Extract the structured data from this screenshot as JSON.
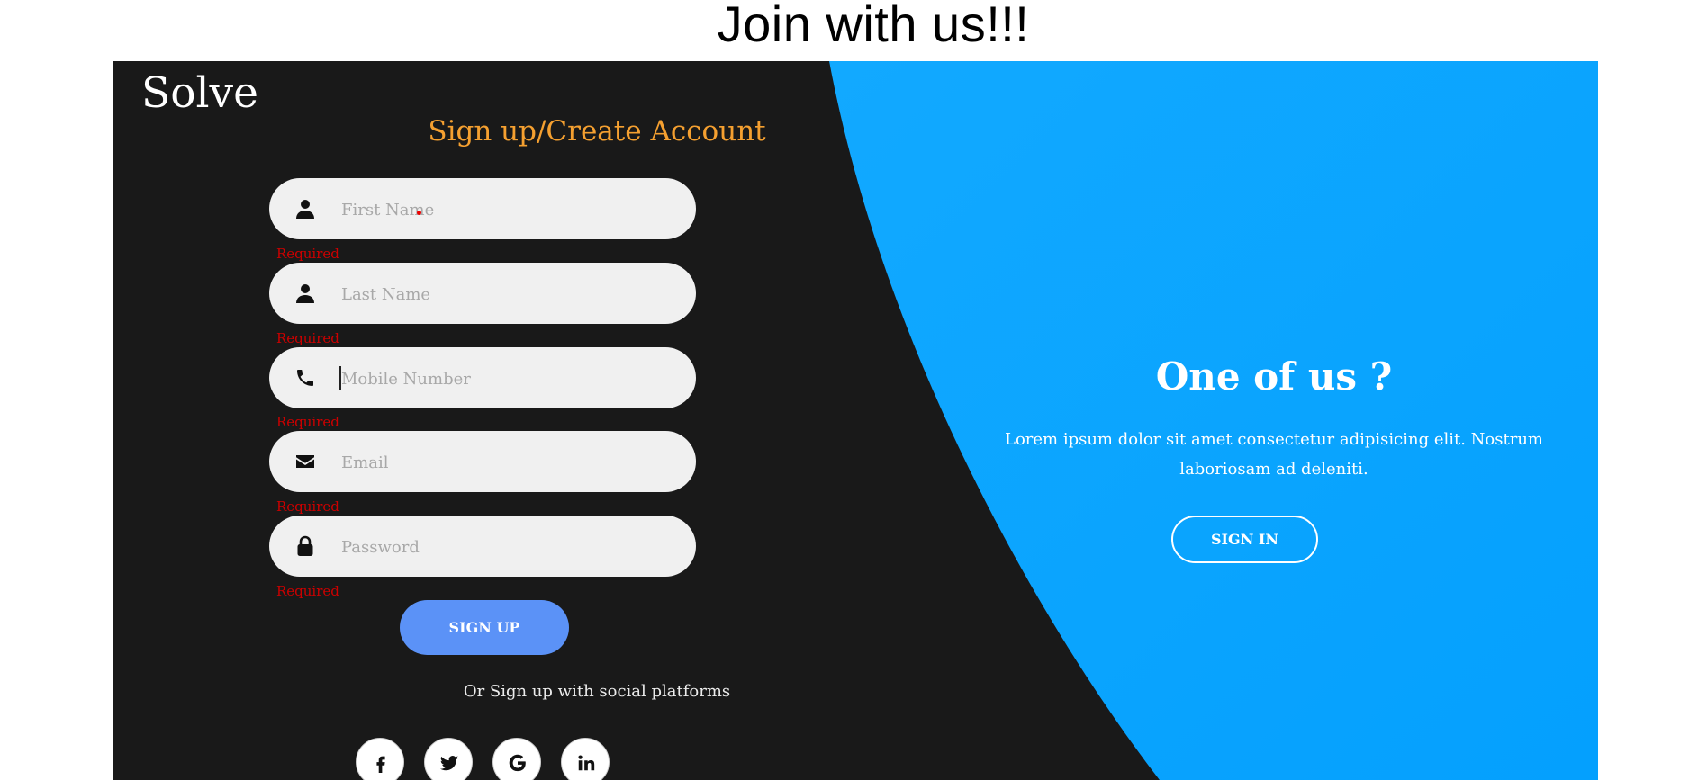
{
  "page_title": "Join with us!!!",
  "brand": "Solve",
  "signup": {
    "title": "Sign up/Create Account",
    "fields": [
      {
        "placeholder": "First Name",
        "icon": "user-icon",
        "error": "Required"
      },
      {
        "placeholder": "Last Name",
        "icon": "user-icon",
        "error": "Required"
      },
      {
        "placeholder": "Mobile Number",
        "icon": "phone-icon",
        "error": "Required"
      },
      {
        "placeholder": "Email",
        "icon": "envelope-icon",
        "error": "Required"
      },
      {
        "placeholder": "Password",
        "icon": "lock-icon",
        "error": "Required"
      }
    ],
    "button_label": "SIGN UP",
    "social_text": "Or Sign up with social platforms",
    "social": [
      "facebook-icon",
      "twitter-icon",
      "google-icon",
      "linkedin-icon"
    ]
  },
  "signin_panel": {
    "title": "One of us ?",
    "text": "Lorem ipsum dolor sit amet consectetur adipisicing elit. Nostrum laboriosam ad deleniti.",
    "button_label": "SIGN IN"
  },
  "colors": {
    "panel_bg": "#191919",
    "accent_blue": "#0fa3ff",
    "title_orange": "#f5a030",
    "button_blue": "#5b92f7",
    "error_red": "#cc0000"
  }
}
